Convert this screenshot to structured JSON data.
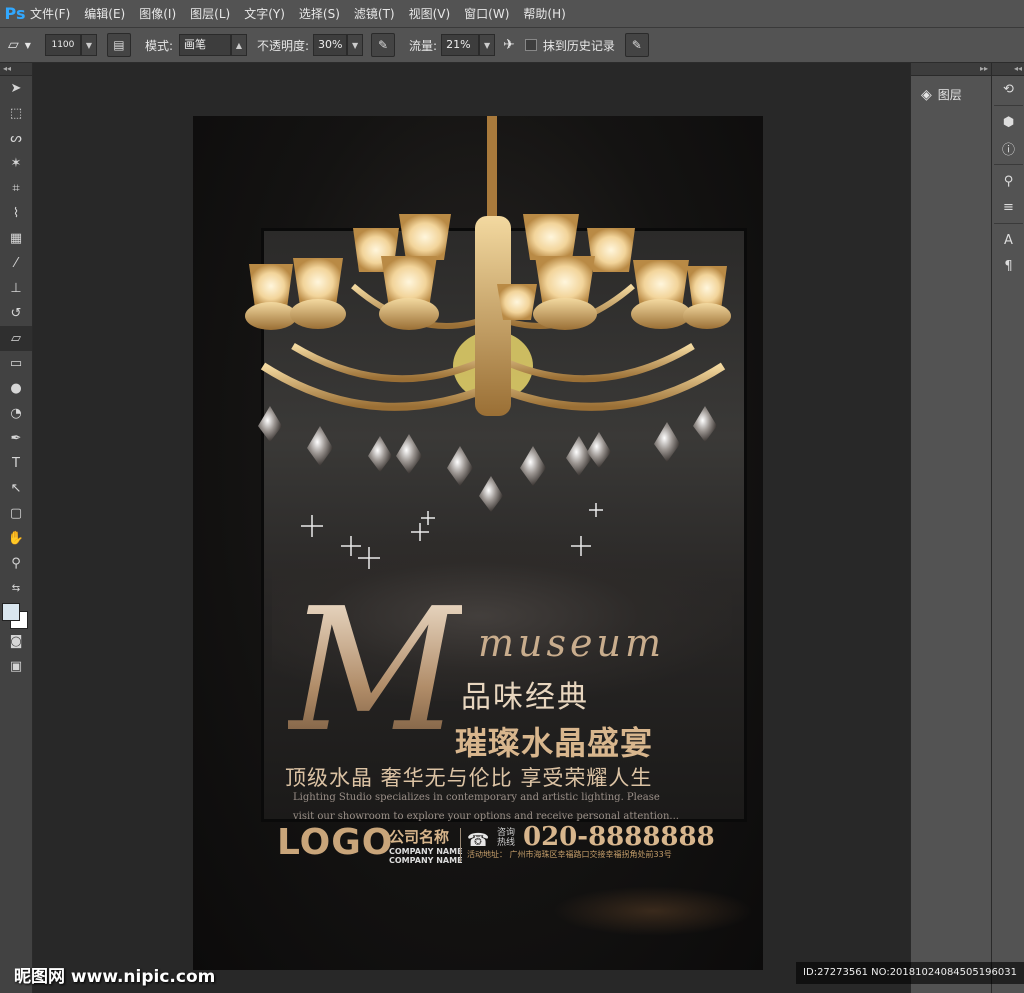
{
  "app": {
    "logo": "Ps"
  },
  "menu": [
    "文件(F)",
    "编辑(E)",
    "图像(I)",
    "图层(L)",
    "文字(Y)",
    "选择(S)",
    "滤镜(T)",
    "视图(V)",
    "窗口(W)",
    "帮助(H)"
  ],
  "options": {
    "brush_size": "1100",
    "mode_label": "模式:",
    "mode_value": "画笔",
    "opacity_label": "不透明度:",
    "opacity_value": "30%",
    "flow_label": "流量:",
    "flow_value": "21%",
    "history_label": "抹到历史记录"
  },
  "panels": {
    "layers_label": "图层"
  },
  "poster": {
    "big_letter": "M",
    "museum": "museum",
    "line1": "品味经典",
    "line2": "璀璨水晶盛宴",
    "line3": "顶级水晶  奢华无与伦比  享受荣耀人生",
    "en_line1": "Lighting Studio specializes in contemporary and artistic lighting. Please",
    "en_line2": "visit our showroom to explore your options and receive personal attention...",
    "logo": "LOGO",
    "company_cn": "公司名称",
    "company_en1": "COMPANY NAME",
    "company_en2": "COMPANY NAME",
    "hotline_1": "咨询",
    "hotline_2": "热线",
    "phone": "020-8888888",
    "address": "活动地址：  广州市海珠区幸福路口交接幸福拐角处前33号"
  },
  "watermark": {
    "site": "昵图网 www.nipic.com",
    "id": "ID:27273561 NO:20181024084505196031"
  },
  "colors": {
    "ui_dark": "#535353",
    "workspace": "#282828",
    "gold": "#d8b68d"
  }
}
